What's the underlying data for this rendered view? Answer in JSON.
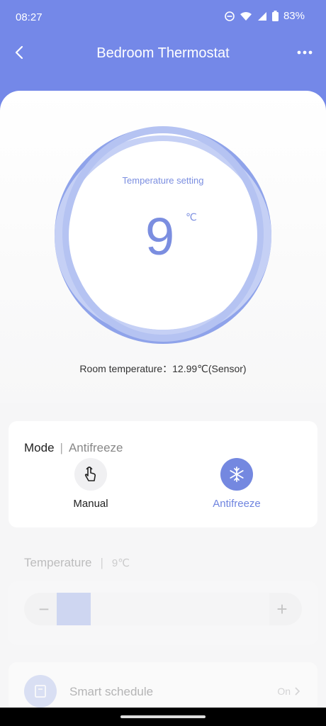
{
  "status": {
    "time": "08:27",
    "battery": "83%"
  },
  "nav": {
    "title": "Bedroom Thermostat"
  },
  "dial": {
    "label": "Temperature setting",
    "value": "9",
    "unit": "℃"
  },
  "room_temperature": "Room temperature：12.99℃(Sensor)",
  "mode": {
    "title": "Mode",
    "separator": "|",
    "current": "Antifreeze",
    "options": [
      {
        "label": "Manual",
        "icon": "hand-pointer-icon"
      },
      {
        "label": "Antifreeze",
        "icon": "snowflake-icon"
      }
    ]
  },
  "temperature": {
    "title": "Temperature",
    "separator": "|",
    "value": "9℃",
    "minus": "−",
    "plus": "+"
  },
  "schedule": {
    "label": "Smart schedule",
    "value": "On"
  },
  "colors": {
    "header": "#7488e8",
    "accent": "#7488e0"
  }
}
